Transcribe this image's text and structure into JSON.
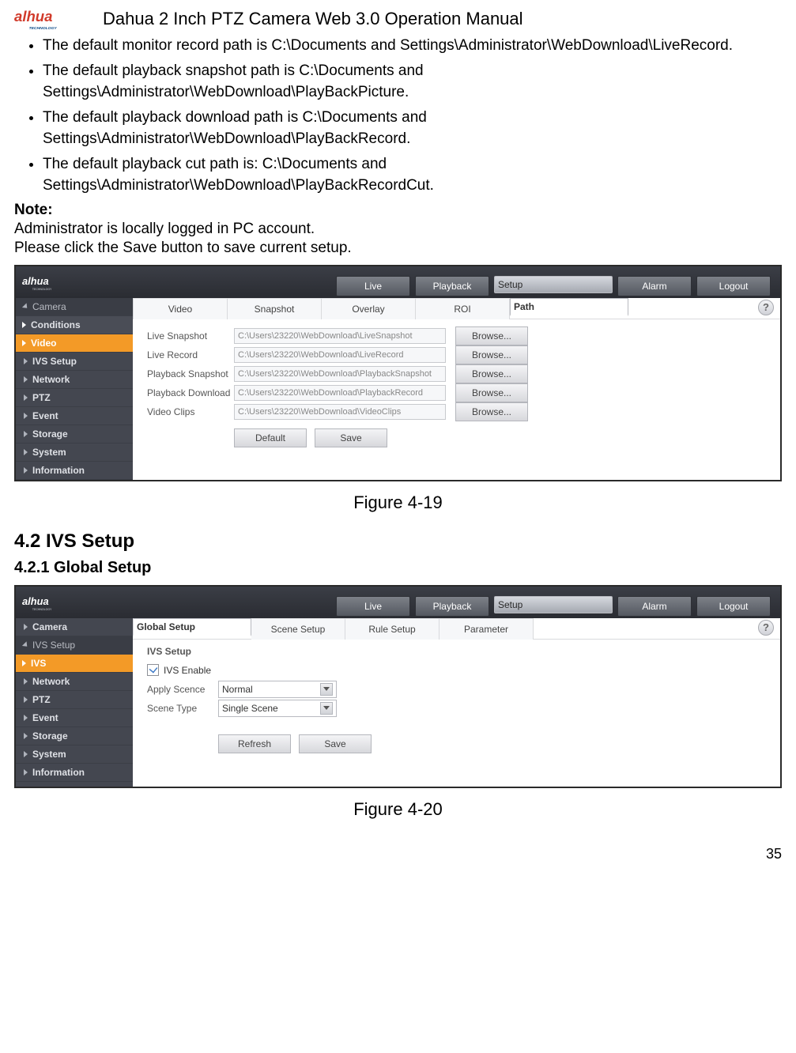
{
  "header": {
    "title": "Dahua 2 Inch PTZ Camera Web 3.0 Operation Manual"
  },
  "bullets": [
    "The default monitor record path is C:\\Documents and Settings\\Administrator\\WebDownload\\LiveRecord.",
    "The default playback snapshot path is C:\\Documents and Settings\\Administrator\\WebDownload\\PlayBackPicture.",
    "The default playback download path is C:\\Documents and Settings\\Administrator\\WebDownload\\PlayBackRecord.",
    "The default playback cut path is: C:\\Documents and Settings\\Administrator\\WebDownload\\PlayBackRecordCut."
  ],
  "note_label": "Note:",
  "note_lines": [
    "Administrator is locally logged in PC account.",
    "Please click the Save button to save current setup."
  ],
  "figcap1": "Figure 4-19",
  "h2": "4.2  IVS Setup",
  "h3": "4.2.1  Global Setup",
  "figcap2": "Figure 4-20",
  "page_number": "35",
  "top_nav": {
    "live": "Live",
    "playback": "Playback",
    "setup": "Setup",
    "alarm": "Alarm",
    "logout": "Logout"
  },
  "help_glyph": "?",
  "shot1": {
    "sidebar": {
      "camera": "Camera",
      "conditions": "Conditions",
      "video": "Video",
      "ivs": "IVS Setup",
      "network": "Network",
      "ptz": "PTZ",
      "event": "Event",
      "storage": "Storage",
      "system": "System",
      "information": "Information"
    },
    "tabs": {
      "video": "Video",
      "snapshot": "Snapshot",
      "overlay": "Overlay",
      "roi": "ROI",
      "path": "Path"
    },
    "rows": [
      {
        "label": "Live Snapshot",
        "value": "C:\\Users\\23220\\WebDownload\\LiveSnapshot",
        "btn": "Browse..."
      },
      {
        "label": "Live Record",
        "value": "C:\\Users\\23220\\WebDownload\\LiveRecord",
        "btn": "Browse..."
      },
      {
        "label": "Playback Snapshot",
        "value": "C:\\Users\\23220\\WebDownload\\PlaybackSnapshot",
        "btn": "Browse..."
      },
      {
        "label": "Playback Download",
        "value": "C:\\Users\\23220\\WebDownload\\PlaybackRecord",
        "btn": "Browse..."
      },
      {
        "label": "Video Clips",
        "value": "C:\\Users\\23220\\WebDownload\\VideoClips",
        "btn": "Browse..."
      }
    ],
    "actions": {
      "default": "Default",
      "save": "Save"
    }
  },
  "shot2": {
    "sidebar": {
      "camera": "Camera",
      "ivs_setup": "IVS Setup",
      "ivs": "IVS",
      "network": "Network",
      "ptz": "PTZ",
      "event": "Event",
      "storage": "Storage",
      "system": "System",
      "information": "Information"
    },
    "tabs": {
      "global": "Global Setup",
      "scene": "Scene Setup",
      "rule": "Rule Setup",
      "param": "Parameter"
    },
    "section": "IVS Setup",
    "enable": "IVS Enable",
    "apply_label": "Apply Scence",
    "apply_value": "Normal",
    "scene_label": "Scene Type",
    "scene_value": "Single Scene",
    "actions": {
      "refresh": "Refresh",
      "save": "Save"
    }
  }
}
